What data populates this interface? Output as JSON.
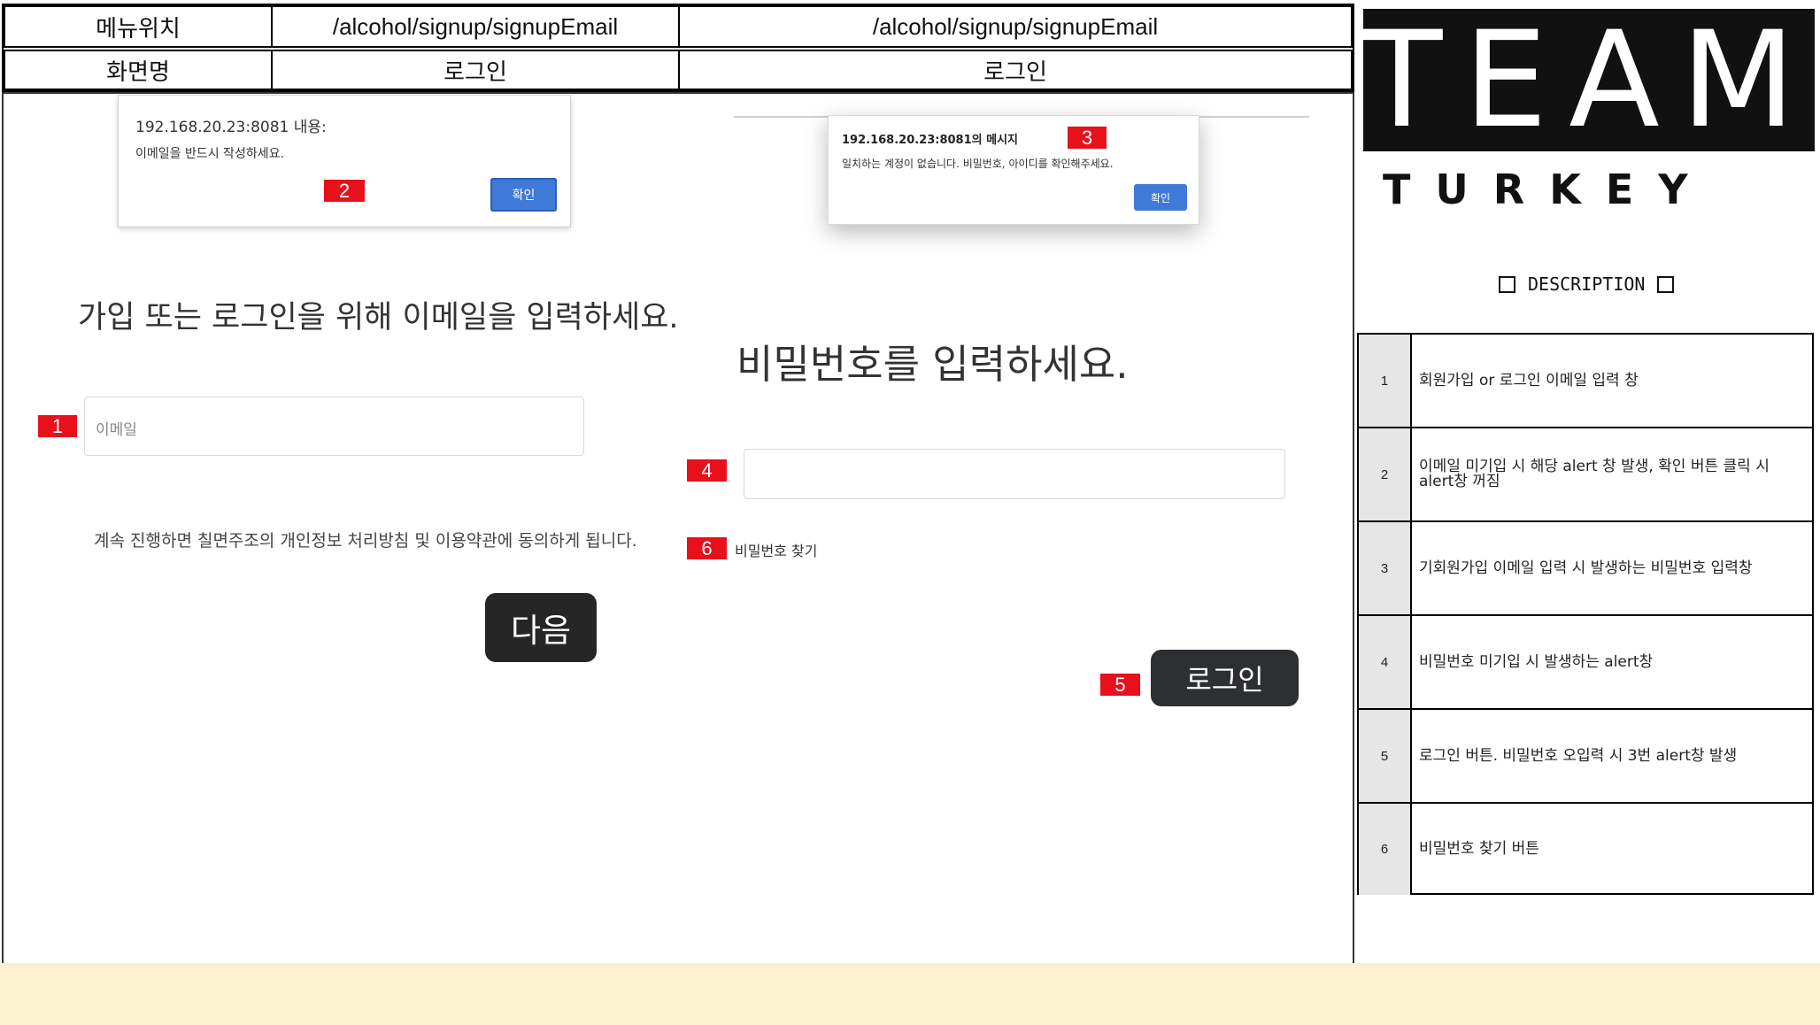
{
  "header": {
    "menu_label": "메뉴위치",
    "menu_value_left": "/alcohol/signup/signupEmail",
    "menu_value_right": "/alcohol/signup/signupEmail",
    "screen_label": "화면명",
    "screen_value_left": "로그인",
    "screen_value_right": "로그인"
  },
  "left_screen": {
    "alert": {
      "title": "192.168.20.23:8081 내용:",
      "message": "이메일을 반드시 작성하세요.",
      "ok_label": "확인"
    },
    "heading": "가입 또는 로그인을 위해 이메일을 입력하세요.",
    "email_placeholder": "이메일",
    "consent_text": "계속 진행하면 칠면주조의 개인정보 처리방침 및 이용약관에 동의하게 됩니다.",
    "next_label": "다음"
  },
  "right_screen": {
    "alert": {
      "title": "192.168.20.23:8081의 메시지",
      "message": "일치하는 계정이 없습니다. 비밀번호, 아이디를 확인해주세요.",
      "ok_label": "확인"
    },
    "heading": "비밀번호를 입력하세요.",
    "find_password": "비밀번호 찾기",
    "login_label": "로그인"
  },
  "markers": [
    "1",
    "2",
    "3",
    "4",
    "5",
    "6"
  ],
  "brand": {
    "team": "TEAM",
    "turkey": "T U R K E Y"
  },
  "description": {
    "title": "DESCRIPTION",
    "rows": [
      {
        "num": "1",
        "text": "회원가입 or 로그인 이메일 입력 창"
      },
      {
        "num": "2",
        "text": "이메일 미기입 시 해당 alert 창 발생, 확인 버튼 클릭 시 alert창 꺼짐"
      },
      {
        "num": "3",
        "text": "기회원가입 이메일 입력 시 발생하는 비밀번호 입력창"
      },
      {
        "num": "4",
        "text": "비밀번호 미기입 시 발생하는 alert창"
      },
      {
        "num": "5",
        "text": "로그인 버튼. 비밀번호 오입력 시 3번 alert창 발생"
      },
      {
        "num": "6",
        "text": "비밀번호 찾기 버튼"
      }
    ]
  },
  "colors": {
    "marker_red": "#e8101b",
    "alert_blue": "#3f7ad8",
    "dark_button": "#262626",
    "footer_band": "#fbf1cf"
  }
}
